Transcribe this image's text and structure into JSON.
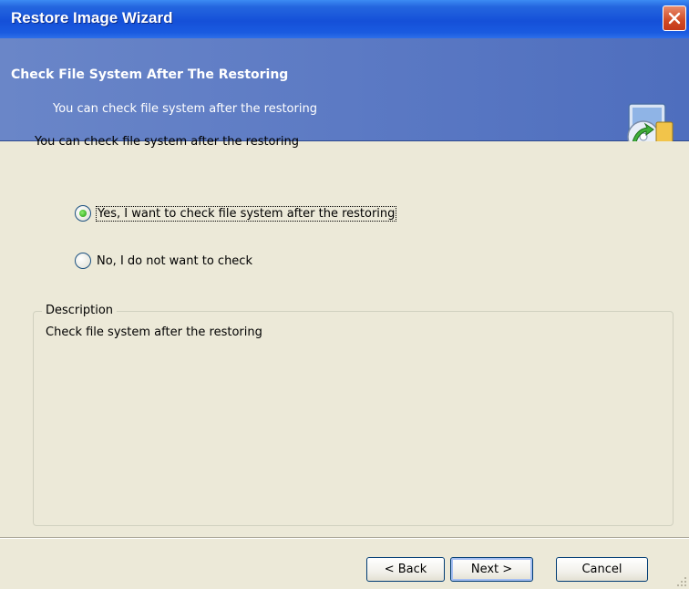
{
  "window": {
    "title": "Restore Image Wizard"
  },
  "header": {
    "title": "Check File System After The Restoring",
    "subtitle": "You can check file system after the restoring",
    "icon": "restore-disk-icon"
  },
  "main": {
    "intro": "You can check file system after the restoring",
    "options": [
      {
        "label": "Yes, I want to check file system after the restoring",
        "selected": true
      },
      {
        "label": "No, I do not want to check",
        "selected": false
      }
    ],
    "description": {
      "legend": "Description",
      "text": "Check file system after the restoring"
    }
  },
  "buttons": {
    "back": "< Back",
    "next": "Next >",
    "cancel": "Cancel"
  },
  "colors": {
    "titlebar": "#1550D8",
    "header": "#5C7AC4",
    "dialog_bg": "#ECE9D8",
    "close": "#D04A23"
  }
}
